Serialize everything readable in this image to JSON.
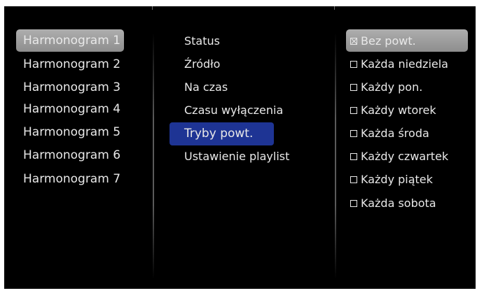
{
  "schedules": {
    "items": [
      {
        "label": "Harmonogram 1",
        "selected": true
      },
      {
        "label": "Harmonogram 2"
      },
      {
        "label": "Harmonogram 3"
      },
      {
        "label": "Harmonogram 4"
      },
      {
        "label": "Harmonogram 5"
      },
      {
        "label": "Harmonogram 6"
      },
      {
        "label": "Harmonogram 7"
      }
    ]
  },
  "settings": {
    "items": [
      {
        "label": "Status"
      },
      {
        "label": "Źródło"
      },
      {
        "label": "Na czas"
      },
      {
        "label": "Czasu wyłączenia"
      },
      {
        "label": "Tryby powt.",
        "highlighted": true
      },
      {
        "label": "Ustawienie playlist"
      }
    ]
  },
  "repeat_modes": {
    "items": [
      {
        "label": "Bez powt.",
        "checked": true
      },
      {
        "label": "Każda niedziela",
        "checked": false
      },
      {
        "label": "Każdy pon.",
        "checked": false
      },
      {
        "label": "Każdy wtorek",
        "checked": false
      },
      {
        "label": "Każda środa",
        "checked": false
      },
      {
        "label": "Każdy czwartek",
        "checked": false
      },
      {
        "label": "Każdy piątek",
        "checked": false
      },
      {
        "label": "Każda sobota",
        "checked": false
      }
    ]
  },
  "colors": {
    "background": "#000000",
    "selection_gray": "#a0a0a0",
    "selection_blue": "#1e3494",
    "text": "#e8e8e8"
  }
}
